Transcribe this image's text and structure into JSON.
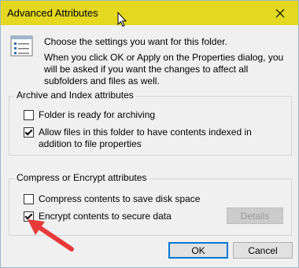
{
  "window": {
    "title": "Advanced Attributes"
  },
  "intro": {
    "line1": "Choose the settings you want for this folder.",
    "line2": "When you click OK or Apply on the Properties dialog, you will be asked if you want the changes to affect all subfolders and files as well."
  },
  "archive_group": {
    "label": "Archive and Index attributes",
    "items": [
      {
        "label": "Folder is ready for archiving",
        "checked": false
      },
      {
        "label": "Allow files in this folder to have contents indexed in addition to file properties",
        "checked": true
      }
    ]
  },
  "compress_group": {
    "label": "Compress or Encrypt attributes",
    "items": [
      {
        "label": "Compress contents to save disk space",
        "checked": false
      },
      {
        "label": "Encrypt contents to secure data",
        "checked": true
      }
    ],
    "details_label": "Details"
  },
  "footer": {
    "ok_label": "OK",
    "cancel_label": "Cancel"
  },
  "icons": {
    "close": "close-icon",
    "cursor": "mouse-cursor-icon",
    "info": "settings-list-icon",
    "annotation": "red-arrow-icon"
  },
  "colors": {
    "titlebar": "#e4d820",
    "annotation_arrow": "#e8393a",
    "default_button_border": "#0078d7"
  }
}
